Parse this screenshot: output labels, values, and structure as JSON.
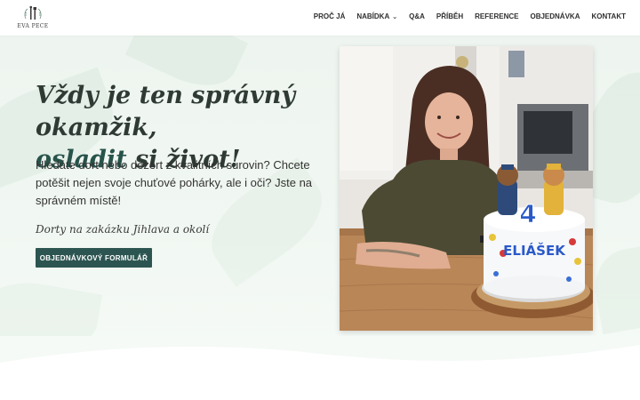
{
  "brand": {
    "logo_text": "EVA PECE"
  },
  "nav": {
    "items": [
      {
        "label": "PROČ JÁ"
      },
      {
        "label": "NABÍDKA",
        "has_dropdown": true
      },
      {
        "label": "Q&A"
      },
      {
        "label": "PŘÍBĚH"
      },
      {
        "label": "REFERENCE"
      },
      {
        "label": "OBJEDNÁVKA"
      },
      {
        "label": "KONTAKT"
      }
    ]
  },
  "hero": {
    "headline_line1": "Vždy je ten správný okamžik,",
    "headline_accent": "osladit",
    "headline_rest": " si život!",
    "intro": "Hledáte dort nebo dezert z kvalitních surovin? Chcete potěšit nejen svoje chuťové pohárky, ale i oči? Jste na správném místě!",
    "tagline": "Dorty na zakázku Jihlava a okolí",
    "cta_label": "OBJEDNÁVKOVÝ FORMULÁŘ",
    "photo_cake_text": "ELIÁŠEK",
    "photo_cake_number": "4"
  },
  "colors": {
    "accent": "#2c5551",
    "hero_bg": "#eef5f0"
  }
}
